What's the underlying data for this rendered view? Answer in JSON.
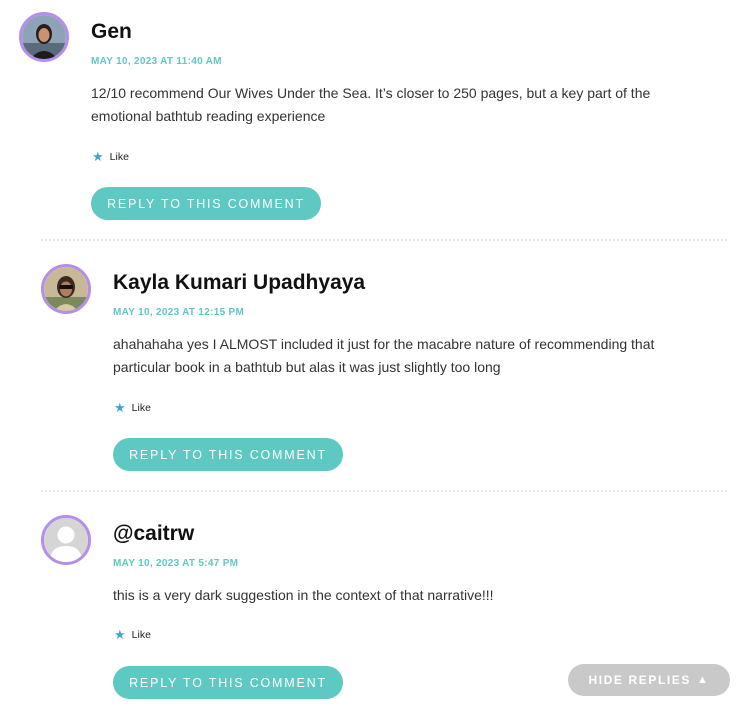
{
  "comments": [
    {
      "author": "Gen",
      "date": "MAY 10, 2023 AT 11:40 AM",
      "text_line1": "12/10 recommend Our Wives Under the Sea. It’s closer to 250 pages, but a key part of the",
      "text_line2": "emotional bathtub reading experience",
      "like_label": "Like",
      "reply_label": "REPLY TO THIS COMMENT"
    },
    {
      "author": "Kayla Kumari Upadhyaya",
      "date": "MAY 10, 2023 AT 12:15 PM",
      "text_line1": "ahahahaha yes I ALMOST included it just for the macabre nature of recommending that",
      "text_line2": "particular book in a bathtub but alas it was just slightly too long",
      "like_label": "Like",
      "reply_label": "REPLY TO THIS COMMENT"
    },
    {
      "author": "@caitrw",
      "date": "MAY 10, 2023 AT 5:47 PM",
      "text_line1": "this is a very dark suggestion in the context of that narrative!!!",
      "like_label": "Like",
      "reply_label": "REPLY TO THIS COMMENT"
    }
  ],
  "hide_replies": {
    "label": "HIDE REPLIES",
    "icon": "triangle-up-icon"
  },
  "colors": {
    "accent_teal": "#5ec8c3",
    "avatar_border": "#b48ee8",
    "like_star": "#3da4d4",
    "hide_replies_bg": "#c9c9c9"
  }
}
